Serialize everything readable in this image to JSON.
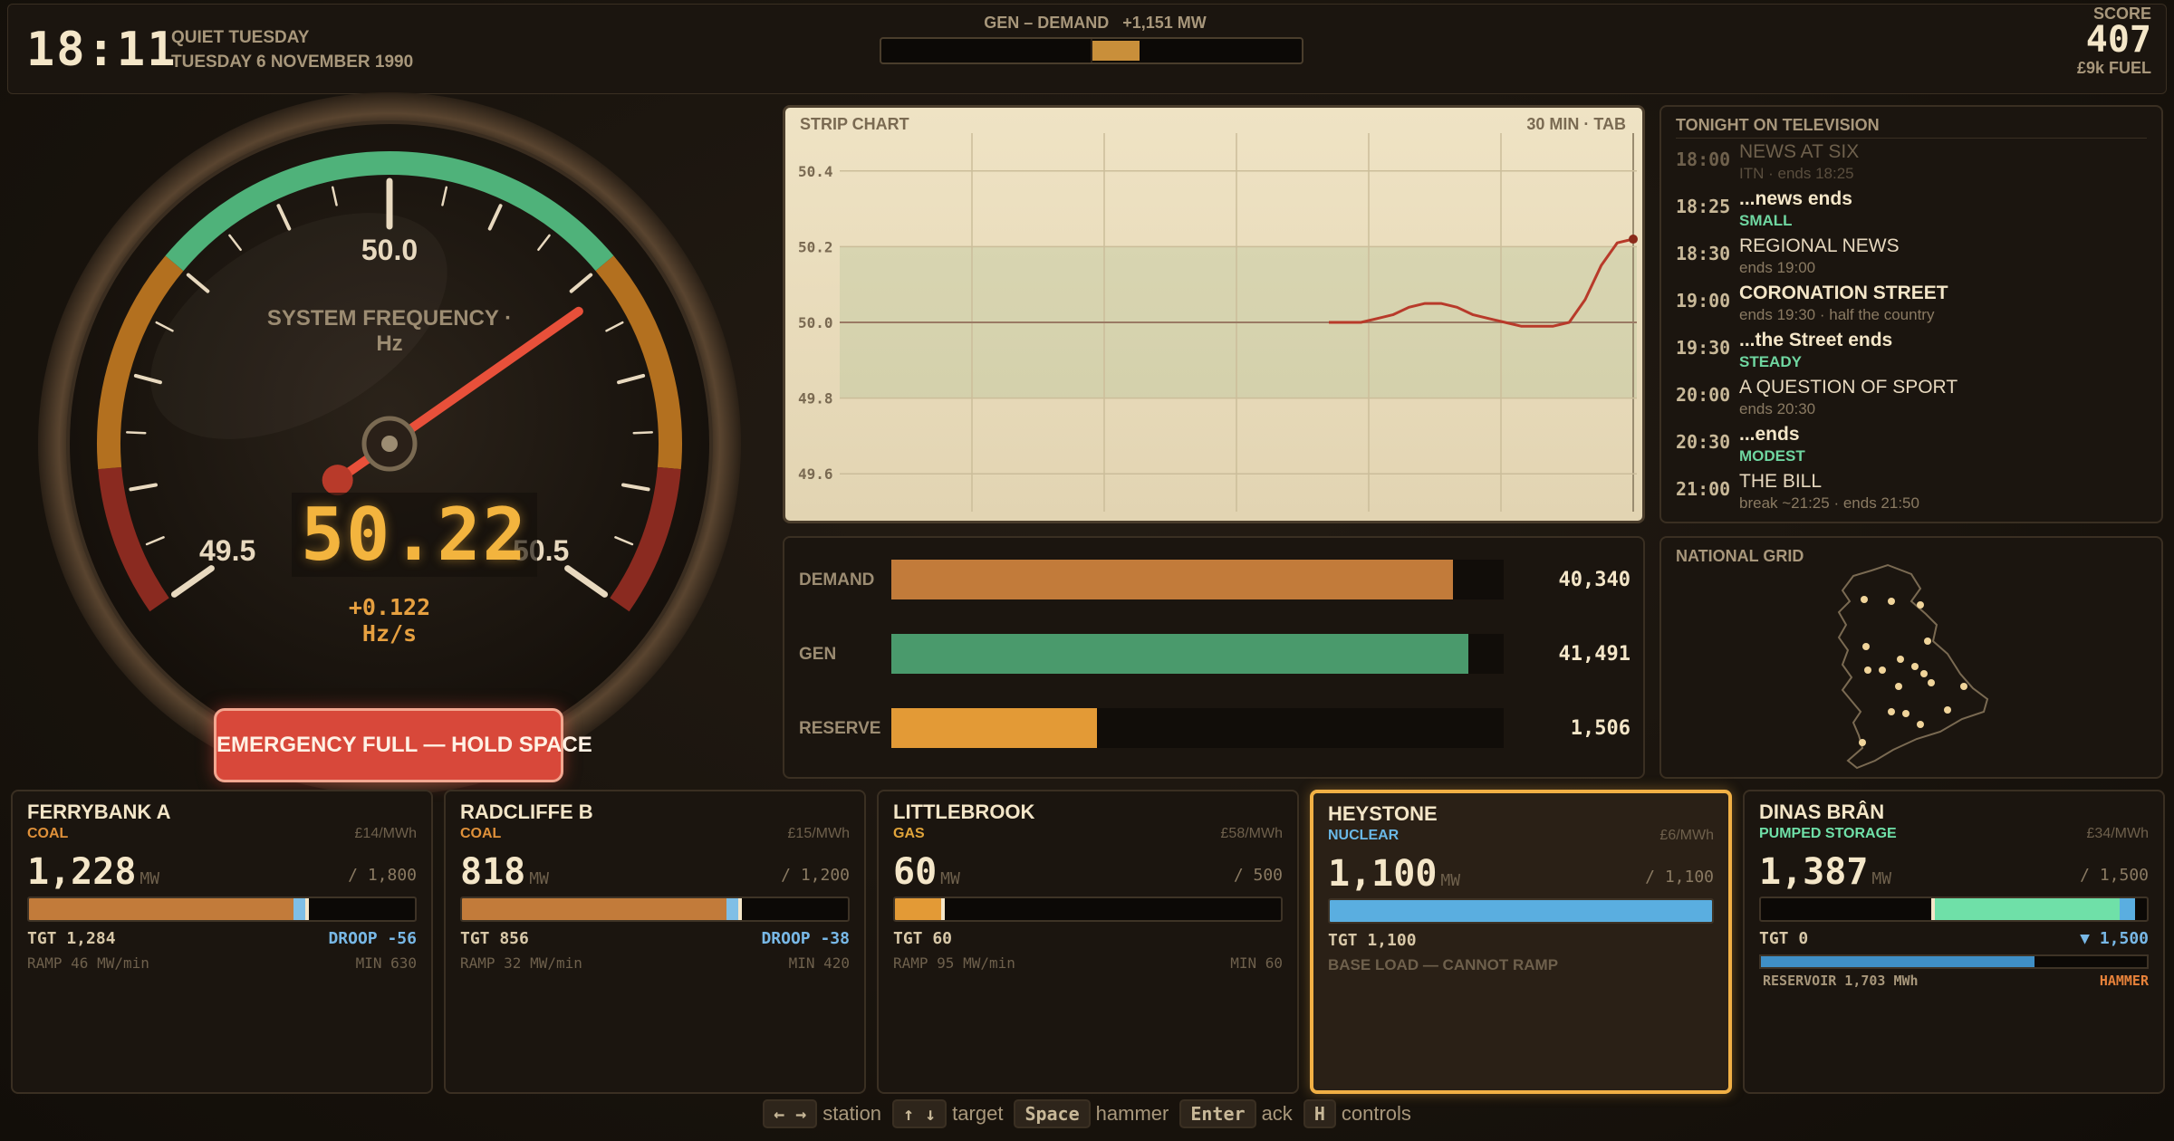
{
  "header": {
    "clock": "18:11",
    "day_label": "QUIET TUESDAY",
    "date_label": "TUESDAY 6 NOVEMBER 1990",
    "gen_demand_label": "GEN – DEMAND",
    "gen_demand_value": "+1,151 MW",
    "gen_demand_fraction": 0.23,
    "score_label": "SCORE",
    "score_value": "407",
    "fuel_label": "£9k FUEL"
  },
  "gauge": {
    "title": "SYSTEM FREQUENCY · Hz",
    "center_label": "50.0",
    "min_label": "49.5",
    "max_label": "50.5",
    "frequency": 50.22,
    "frequency_text": "50.22",
    "rate_text": "+0.122 Hz/s",
    "emergency_label": "EMERGENCY FULL — HOLD SPACE"
  },
  "strip_chart": {
    "title": "STRIP CHART",
    "window_label": "30 MIN · TAB",
    "ticks": [
      "50.4",
      "50.2",
      "50.0",
      "49.8",
      "49.6"
    ]
  },
  "chart_data": {
    "type": "line",
    "title": "STRIP CHART",
    "ylim": [
      49.5,
      50.5
    ],
    "y_ticks": [
      50.4,
      50.2,
      50.0,
      49.8,
      49.6
    ],
    "band": [
      49.8,
      50.2
    ],
    "series": [
      {
        "x": [
          0,
          1,
          2,
          3,
          4,
          5,
          6,
          7,
          8,
          9,
          10,
          11,
          12,
          13,
          14,
          15,
          16,
          17,
          18,
          19
        ],
        "values": [
          50.0,
          50.0,
          50.0,
          50.01,
          50.02,
          50.04,
          50.05,
          50.05,
          50.04,
          50.02,
          50.01,
          50.0,
          49.99,
          49.99,
          49.99,
          50.0,
          50.06,
          50.15,
          50.21,
          50.22
        ]
      }
    ]
  },
  "power": {
    "rows": [
      {
        "label": "DEMAND",
        "value": "40,340",
        "fraction": 0.917,
        "color": "#c27b3a"
      },
      {
        "label": "GEN",
        "value": "41,491",
        "fraction": 0.943,
        "color": "#4a9a6c"
      },
      {
        "label": "RESERVE",
        "value": "1,506",
        "fraction": 0.336,
        "color": "#e39a36"
      }
    ]
  },
  "tv": {
    "title": "TONIGHT ON TELEVISION",
    "items": [
      {
        "time": "18:00",
        "name": "NEWS AT SIX",
        "sub": "ITN · ends 18:25",
        "kind": "past"
      },
      {
        "time": "18:25",
        "name": "...news ends",
        "sub": "SMALL",
        "kind": "surge"
      },
      {
        "time": "18:30",
        "name": "REGIONAL NEWS",
        "sub": "ends 19:00",
        "kind": "normal"
      },
      {
        "time": "19:00",
        "name": "CORONATION STREET",
        "sub": "ends 19:30 · half the country",
        "kind": "bold"
      },
      {
        "time": "19:30",
        "name": "...the Street ends",
        "sub": "STEADY",
        "kind": "surge"
      },
      {
        "time": "20:00",
        "name": "A QUESTION OF SPORT",
        "sub": "ends 20:30",
        "kind": "normal"
      },
      {
        "time": "20:30",
        "name": "...ends",
        "sub": "MODEST",
        "kind": "surge"
      },
      {
        "time": "21:00",
        "name": "THE BILL",
        "sub": "break ~21:25 · ends 21:50",
        "kind": "normal"
      }
    ]
  },
  "map": {
    "title": "NATIONAL GRID"
  },
  "stations": [
    {
      "name": "FERRYBANK A",
      "type": "COAL",
      "type_color": "#e0913a",
      "cost": "£14/MWh",
      "output": "1,228",
      "unit": "MW",
      "capacity": "/ 1,800",
      "output_fraction": 0.682,
      "target_fraction": 0.713,
      "fill_color": "#c27b3a",
      "tgt": "TGT 1,284",
      "right": "DROOP -56",
      "ramp": "RAMP 46 MW/min",
      "min": "MIN 630"
    },
    {
      "name": "RADCLIFFE B",
      "type": "COAL",
      "type_color": "#e0913a",
      "cost": "£15/MWh",
      "output": "818",
      "unit": "MW",
      "capacity": "/ 1,200",
      "output_fraction": 0.682,
      "target_fraction": 0.713,
      "fill_color": "#c27b3a",
      "tgt": "TGT 856",
      "right": "DROOP -38",
      "ramp": "RAMP 32 MW/min",
      "min": "MIN 420"
    },
    {
      "name": "LITTLEBROOK",
      "type": "GAS",
      "type_color": "#e0a43a",
      "cost": "£58/MWh",
      "output": "60",
      "unit": "MW",
      "capacity": "/ 500",
      "output_fraction": 0.12,
      "target_fraction": 0.12,
      "fill_color": "#e39a36",
      "tgt": "TGT 60",
      "right": "",
      "ramp": "RAMP 95 MW/min",
      "min": "MIN 60"
    },
    {
      "name": "HEYSTONE",
      "type": "NUCLEAR",
      "type_color": "#6ab8e6",
      "cost": "£6/MWh",
      "output": "1,100",
      "unit": "MW",
      "capacity": "/ 1,100",
      "output_fraction": 1.0,
      "target_fraction": 1.0,
      "fill_color": "#5aaee0",
      "tgt": "TGT 1,100",
      "base_note": "BASE LOAD — CANNOT RAMP"
    },
    {
      "name": "DINAS BRÂN",
      "type": "PUMPED STORAGE",
      "type_color": "#6fe0a8",
      "cost": "£34/MWh",
      "output": "1,387",
      "unit": "MW",
      "capacity": "/ 1,500",
      "output_fraction": 0.925,
      "target_fraction": 0.0,
      "fill_color": "#6fe0a8",
      "tgt": "TGT 0",
      "right": "▼ 1,500",
      "reservoir_fraction": 0.71,
      "reservoir_label": "RESERVOIR 1,703 MWh",
      "hammer_label": "HAMMER"
    }
  ],
  "footer": {
    "keys": [
      {
        "key": "← →",
        "desc": "station"
      },
      {
        "key": "↑ ↓",
        "desc": "target"
      },
      {
        "key": "Space",
        "desc": "hammer"
      },
      {
        "key": "Enter",
        "desc": "ack"
      },
      {
        "key": "H",
        "desc": "controls"
      }
    ]
  }
}
